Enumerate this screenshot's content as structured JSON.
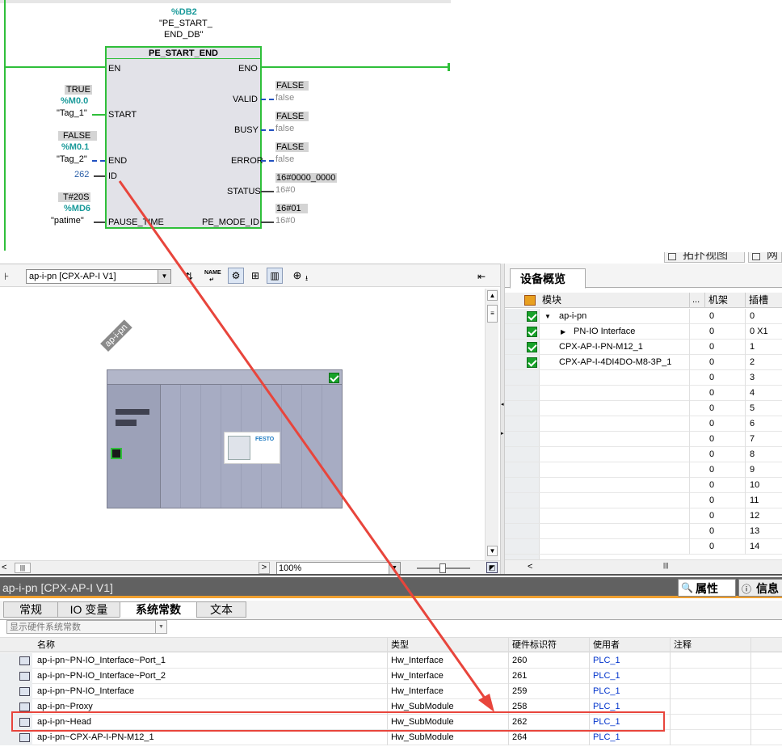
{
  "ladder": {
    "db_name": "%DB2",
    "db_label_1": "\"PE_START_",
    "db_label_2": "END_DB\"",
    "block_title": "PE_START_END",
    "pin_en": "EN",
    "pin_eno": "ENO",
    "pin_start": "START",
    "pin_end": "END",
    "pin_id": "ID",
    "pin_pause": "PAUSE_TIME",
    "pin_valid": "VALID",
    "pin_busy": "BUSY",
    "pin_error": "ERROR",
    "pin_status": "STATUS",
    "pin_pe_mode": "PE_MODE_ID",
    "start_value": "TRUE",
    "start_addr": "%M0.0",
    "start_tag": "\"Tag_1\"",
    "end_value": "FALSE",
    "end_addr": "%M0.1",
    "end_tag": "\"Tag_2\"",
    "id_value": "262",
    "pause_value": "T#20S",
    "pause_addr": "%MD6",
    "pause_tag": "\"patime\"",
    "valid_value": "FALSE",
    "valid_live": "false",
    "busy_value": "FALSE",
    "busy_live": "false",
    "error_value": "FALSE",
    "error_live": "false",
    "status_value": "16#0000_0000",
    "status_live": "16#0",
    "pe_mode_value": "16#01",
    "pe_mode_live": "16#0"
  },
  "top_tabs": {
    "topology": "拓扑视图",
    "network": "网"
  },
  "device_view": {
    "device_select": "ap-i-pn [CPX-AP-I V1]",
    "device_label": "ap-i-pn",
    "zoom": "100%",
    "festo_label": "FESTO"
  },
  "overview": {
    "title": "设备概览",
    "col_module": "模块",
    "col_dots": "...",
    "col_rack": "机架",
    "col_slot": "插槽",
    "rows": [
      {
        "module": "ap-i-pn",
        "rack": "0",
        "slot": "0"
      },
      {
        "module": "PN-IO Interface",
        "rack": "0",
        "slot": "0 X1"
      },
      {
        "module": "CPX-AP-I-PN-M12_1",
        "rack": "0",
        "slot": "1"
      },
      {
        "module": "CPX-AP-I-4DI4DO-M8-3P_1",
        "rack": "0",
        "slot": "2"
      },
      {
        "module": "",
        "rack": "0",
        "slot": "3"
      },
      {
        "module": "",
        "rack": "0",
        "slot": "4"
      },
      {
        "module": "",
        "rack": "0",
        "slot": "5"
      },
      {
        "module": "",
        "rack": "0",
        "slot": "6"
      },
      {
        "module": "",
        "rack": "0",
        "slot": "7"
      },
      {
        "module": "",
        "rack": "0",
        "slot": "8"
      },
      {
        "module": "",
        "rack": "0",
        "slot": "9"
      },
      {
        "module": "",
        "rack": "0",
        "slot": "10"
      },
      {
        "module": "",
        "rack": "0",
        "slot": "11"
      },
      {
        "module": "",
        "rack": "0",
        "slot": "12"
      },
      {
        "module": "",
        "rack": "0",
        "slot": "13"
      },
      {
        "module": "",
        "rack": "0",
        "slot": "14"
      }
    ]
  },
  "properties": {
    "header_title": "ap-i-pn [CPX-AP-I V1]",
    "btn_properties": "属性",
    "btn_info": "信息",
    "tabs": [
      "常规",
      "IO 变量",
      "系统常数",
      "文本"
    ],
    "filter": "显示硬件系统常数",
    "columns": [
      "名称",
      "类型",
      "硬件标识符",
      "使用者",
      "注释"
    ],
    "rows": [
      {
        "name": "ap-i-pn~PN-IO_Interface~Port_1",
        "type": "Hw_Interface",
        "hwid": "260",
        "user": "PLC_1"
      },
      {
        "name": "ap-i-pn~PN-IO_Interface~Port_2",
        "type": "Hw_Interface",
        "hwid": "261",
        "user": "PLC_1"
      },
      {
        "name": "ap-i-pn~PN-IO_Interface",
        "type": "Hw_Interface",
        "hwid": "259",
        "user": "PLC_1"
      },
      {
        "name": "ap-i-pn~Proxy",
        "type": "Hw_SubModule",
        "hwid": "258",
        "user": "PLC_1"
      },
      {
        "name": "ap-i-pn~Head",
        "type": "Hw_SubModule",
        "hwid": "262",
        "user": "PLC_1"
      },
      {
        "name": "ap-i-pn~CPX-AP-I-PN-M12_1",
        "type": "Hw_SubModule",
        "hwid": "264",
        "user": "PLC_1"
      }
    ]
  },
  "colors": {
    "rung_green": "#2fbf3a",
    "addr_teal": "#1a9a9a",
    "live_grey": "#8a8a8a",
    "accent_orange": "#f0a030",
    "annotation_red": "#e8453c"
  }
}
